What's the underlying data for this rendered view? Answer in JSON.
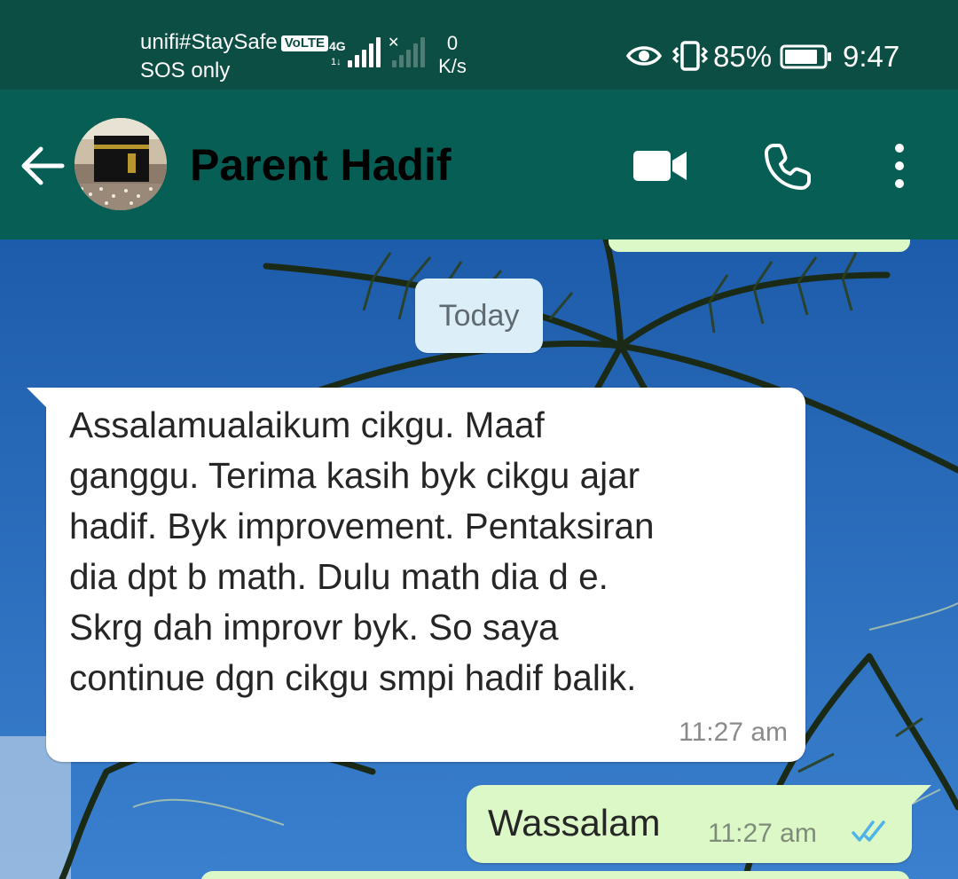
{
  "status_bar": {
    "carrier": "unifi#StaySafe",
    "volte_badge": "VoLTE",
    "sos": "SOS only",
    "network_type": "4G",
    "network_sub": "1↓",
    "speed_value": "0",
    "speed_unit": "K/s",
    "battery_percent": "85%",
    "time": "9:47",
    "icons": [
      "eye-icon",
      "vibrate-icon",
      "battery-icon",
      "signal-icon"
    ]
  },
  "app_bar": {
    "contact_name": "Parent Hadif",
    "icons": [
      "back-arrow-icon",
      "video-call-icon",
      "phone-icon",
      "more-options-icon"
    ],
    "header_color": "#075e54"
  },
  "chat": {
    "date_chip": "Today",
    "messages": [
      {
        "direction": "incoming",
        "lines": [
          "Assalamualaikum cikgu. Maaf",
          "ganggu. Terima kasih byk cikgu ajar",
          "hadif. Byk improvement. Pentaksiran",
          "dia dpt b math. Dulu math dia d e.",
          "Skrg dah improvr byk. So saya",
          "continue dgn cikgu smpi hadif balik."
        ],
        "time": "11:27 am"
      },
      {
        "direction": "outgoing",
        "text": "Wassalam",
        "time": "11:27 am",
        "status": "read"
      }
    ],
    "colors": {
      "outgoing_bubble": "#dcf8c6",
      "incoming_bubble": "#ffffff",
      "read_ticks": "#4fb3e8"
    }
  }
}
